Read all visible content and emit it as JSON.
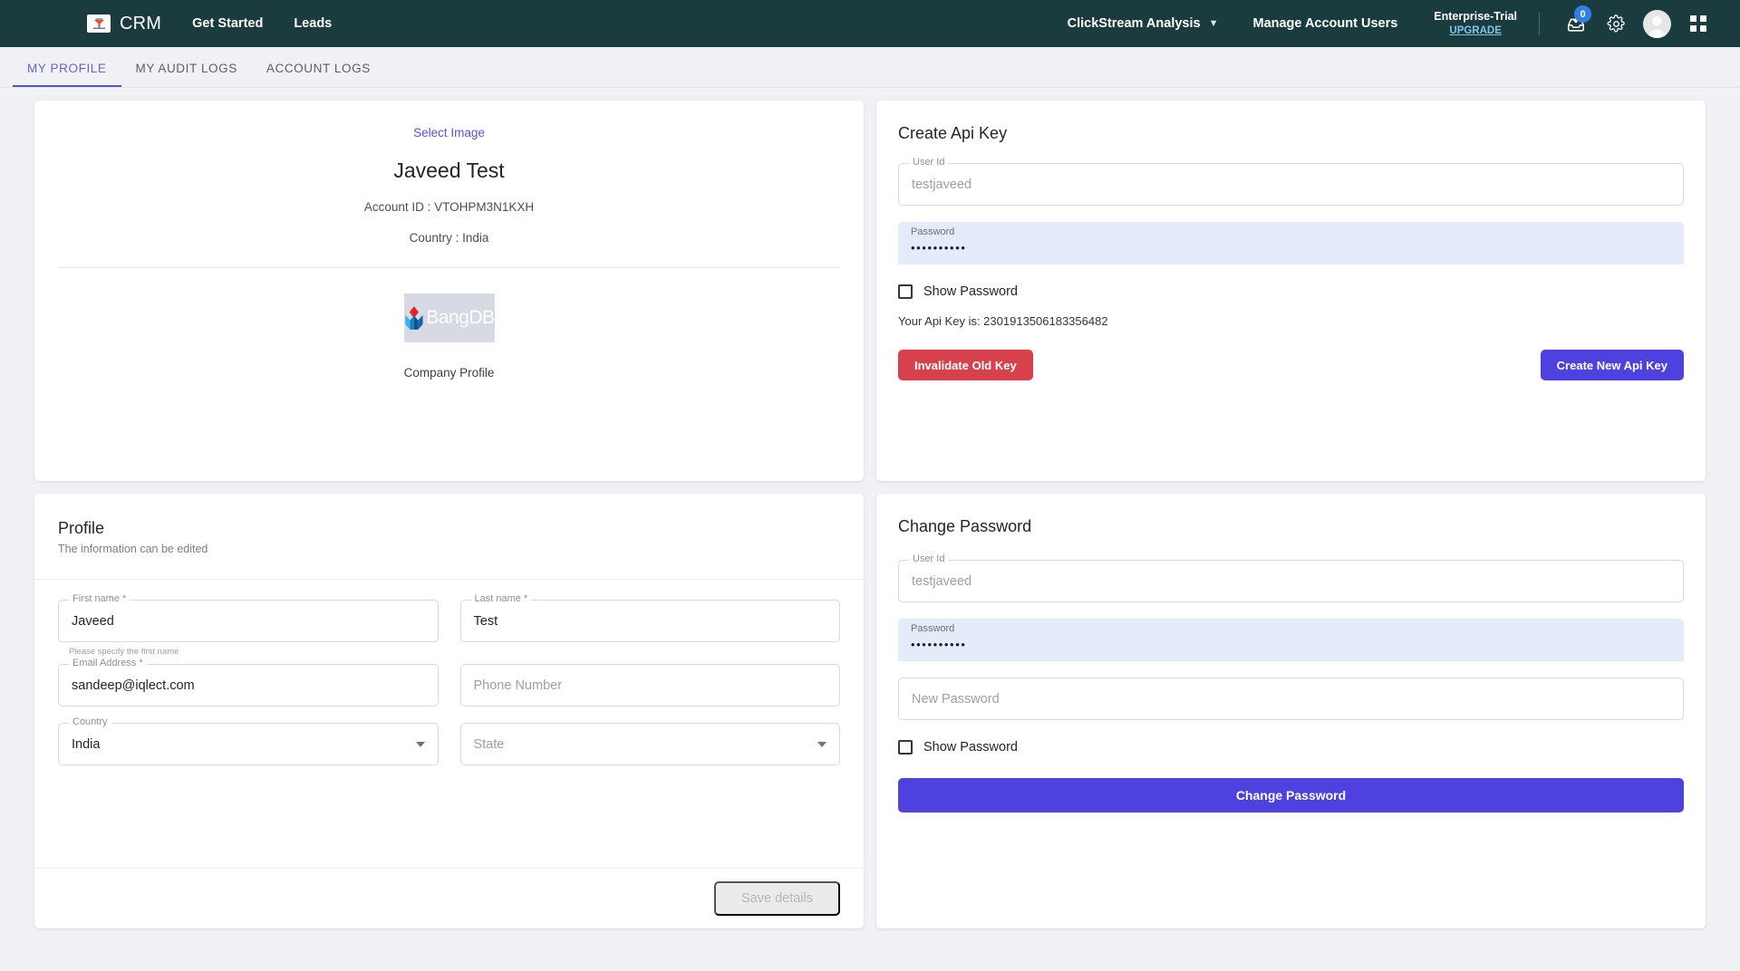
{
  "navbar": {
    "brand_icon": "crm-funnel-icon",
    "brand": "CRM",
    "links": [
      {
        "label": "Get Started"
      },
      {
        "label": "Leads"
      }
    ],
    "analysis_menu": "ClickStream Analysis",
    "manage_users": "Manage Account Users",
    "plan": "Enterprise-Trial",
    "upgrade": "UPGRADE",
    "notification_count": "0",
    "icons": [
      "inbox-download-icon",
      "gear-icon",
      "avatar",
      "apps-grid-icon"
    ]
  },
  "tabs": [
    {
      "label": "MY PROFILE",
      "active": true
    },
    {
      "label": "MY AUDIT LOGS",
      "active": false
    },
    {
      "label": "ACCOUNT LOGS",
      "active": false
    }
  ],
  "profile_summary": {
    "select_image": "Select Image",
    "name": "Javeed Test",
    "account_id": "Account ID : VTOHPM3N1KXH",
    "country": "Country : India",
    "logo_text": "BangDB",
    "company_profile": "Company Profile"
  },
  "api_key": {
    "title": "Create Api Key",
    "user_id_label": "User Id",
    "user_id_value": "testjaveed",
    "password_label": "Password",
    "password_masked": "••••••••••",
    "show_password": "Show Password",
    "key_line": "Your Api Key is: 2301913506183356482",
    "invalidate_button": "Invalidate Old Key",
    "create_button": "Create New Api Key"
  },
  "profile_form": {
    "title": "Profile",
    "subtitle": "The information can be edited",
    "first_name_label": "First name *",
    "first_name_value": "Javeed",
    "first_name_helper": "Please specify the first name",
    "last_name_label": "Last name *",
    "last_name_value": "Test",
    "email_label": "Email Address *",
    "email_value": "sandeep@iqlect.com",
    "phone_placeholder": "Phone Number",
    "country_label": "Country",
    "country_value": "India",
    "state_placeholder": "State",
    "save_button": "Save details"
  },
  "change_password": {
    "title": "Change Password",
    "user_id_label": "User Id",
    "user_id_value": "testjaveed",
    "password_label": "Password",
    "password_masked": "••••••••••",
    "new_password_placeholder": "New Password",
    "show_password": "Show Password",
    "submit_button": "Change Password"
  },
  "colors": {
    "navbar": "#1a3c3f",
    "accent_purple": "#5c52d6",
    "tab_active": "#6b62c4",
    "danger_red": "#d6414b",
    "primary_blue": "#4e41e0",
    "page_bg": "#f0f1f5",
    "field_filled": "#e4ecfb",
    "badge_blue": "#2f7fe8"
  }
}
